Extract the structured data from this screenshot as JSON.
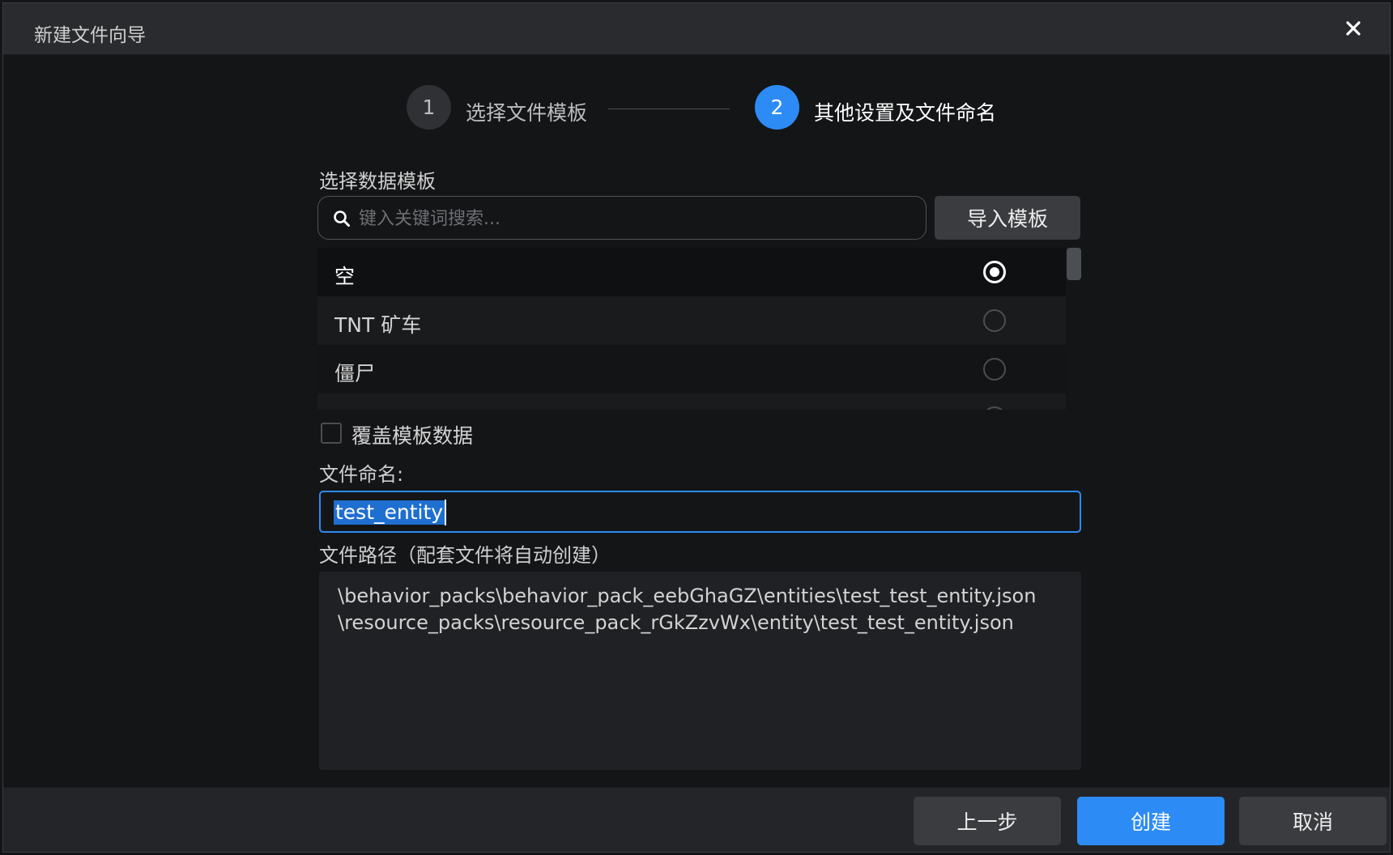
{
  "window": {
    "title": "新建文件向导"
  },
  "stepper": {
    "steps": [
      {
        "number": "1",
        "label": "选择文件模板",
        "state": "done"
      },
      {
        "number": "2",
        "label": "其他设置及文件命名",
        "state": "active"
      }
    ]
  },
  "template": {
    "label": "选择数据模板",
    "search_placeholder": "键入关键词搜索...",
    "import_button": "导入模板",
    "items": [
      {
        "name": "空",
        "selected": true
      },
      {
        "name": "TNT 矿车",
        "selected": false
      },
      {
        "name": "僵尸",
        "selected": false
      }
    ]
  },
  "override": {
    "label": "覆盖模板数据",
    "checked": false
  },
  "filename": {
    "label": "文件命名:",
    "value": "test_entity"
  },
  "filepath": {
    "label": "文件路径（配套文件将自动创建）",
    "lines": [
      "\\behavior_packs\\behavior_pack_eebGhaGZ\\entities\\test_test_entity.json",
      "\\resource_packs\\resource_pack_rGkZzvWx\\entity\\test_test_entity.json"
    ]
  },
  "footer": {
    "prev": "上一步",
    "create": "创建",
    "cancel": "取消"
  },
  "colors": {
    "accent": "#2d8bf5",
    "background": "#141517",
    "titlebar": "#2a2b2e"
  }
}
